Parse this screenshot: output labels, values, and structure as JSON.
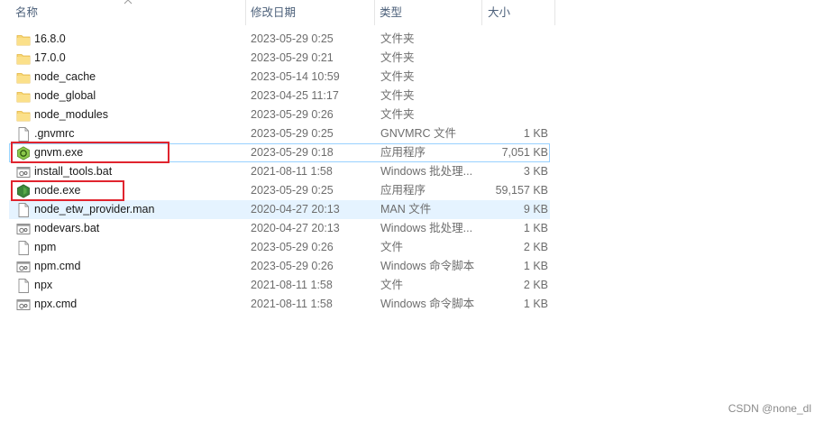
{
  "columns": {
    "name": "名称",
    "date": "修改日期",
    "type": "类型",
    "size": "大小"
  },
  "files": [
    {
      "name": "16.8.0",
      "date": "2023-05-29 0:25",
      "type": "文件夹",
      "size": "",
      "icon": "folder-icon"
    },
    {
      "name": "17.0.0",
      "date": "2023-05-29 0:21",
      "type": "文件夹",
      "size": "",
      "icon": "folder-icon"
    },
    {
      "name": "node_cache",
      "date": "2023-05-14 10:59",
      "type": "文件夹",
      "size": "",
      "icon": "folder-icon"
    },
    {
      "name": "node_global",
      "date": "2023-04-25 11:17",
      "type": "文件夹",
      "size": "",
      "icon": "folder-icon"
    },
    {
      "name": "node_modules",
      "date": "2023-05-29 0:26",
      "type": "文件夹",
      "size": "",
      "icon": "folder-icon"
    },
    {
      "name": ".gnvmrc",
      "date": "2023-05-29 0:25",
      "type": "GNVMRC 文件",
      "size": "1 KB",
      "icon": "file-icon"
    },
    {
      "name": "gnvm.exe",
      "date": "2023-05-29 0:18",
      "type": "应用程序",
      "size": "7,051 KB",
      "icon": "gnvm-app-icon"
    },
    {
      "name": "install_tools.bat",
      "date": "2021-08-11 1:58",
      "type": "Windows 批处理...",
      "size": "3 KB",
      "icon": "batch-file-icon"
    },
    {
      "name": "node.exe",
      "date": "2023-05-29 0:25",
      "type": "应用程序",
      "size": "59,157 KB",
      "icon": "nodejs-app-icon"
    },
    {
      "name": "node_etw_provider.man",
      "date": "2020-04-27 20:13",
      "type": "MAN 文件",
      "size": "9 KB",
      "icon": "file-icon"
    },
    {
      "name": "nodevars.bat",
      "date": "2020-04-27 20:13",
      "type": "Windows 批处理...",
      "size": "1 KB",
      "icon": "batch-file-icon"
    },
    {
      "name": "npm",
      "date": "2023-05-29 0:26",
      "type": "文件",
      "size": "2 KB",
      "icon": "file-icon"
    },
    {
      "name": "npm.cmd",
      "date": "2023-05-29 0:26",
      "type": "Windows 命令脚本",
      "size": "1 KB",
      "icon": "batch-file-icon"
    },
    {
      "name": "npx",
      "date": "2021-08-11 1:58",
      "type": "文件",
      "size": "2 KB",
      "icon": "file-icon"
    },
    {
      "name": "npx.cmd",
      "date": "2021-08-11 1:58",
      "type": "Windows 命令脚本",
      "size": "1 KB",
      "icon": "batch-file-icon"
    }
  ],
  "watermark": "CSDN @none_dl",
  "colors": {
    "highlight_box": "#e0242e",
    "folder": "#f8d775",
    "node_green": "#3c873a",
    "gnvm_green": "#8cc84b",
    "hover_row": "#e5f3ff",
    "selected_outline": "#99d1ff"
  }
}
